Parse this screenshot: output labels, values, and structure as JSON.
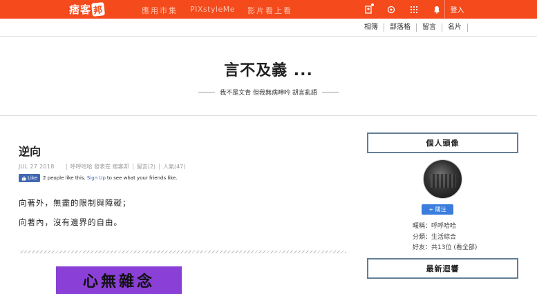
{
  "topbar": {
    "logo_text": "痞客",
    "logo_box": "邦",
    "nav": [
      "應用市集",
      "PIXstyleMe",
      "影片看上看"
    ],
    "icons": [
      "bookmark-icon",
      "search-icon",
      "grid-icon",
      "bell-icon"
    ],
    "login_label": "登入",
    "bg_color": "#f44a1c"
  },
  "subnav": [
    "相簿",
    "部落格",
    "留言",
    "名片"
  ],
  "header": {
    "title": "言不及義 ...",
    "subtitle": "我不是文青 但我無病呻吟 胡言亂語"
  },
  "post": {
    "title": "逆向",
    "date": "JUL 27 2018",
    "author": "呼呼哈哈",
    "posted_in": "發表在",
    "site": "痞客邦",
    "comments": "留言(2)",
    "views": "人氣(47)",
    "fb_like": "Like",
    "fb_count_text": "2 people like this.",
    "fb_signup": "Sign Up",
    "fb_tail": "to see what your friends like.",
    "paragraphs": [
      "向著外，無盡的限制與障礙；",
      "向著內，沒有邊界的自由。"
    ],
    "image_text": "心無雜念"
  },
  "sidebar": {
    "profile_title": "個人頭像",
    "follow_label": "+ 關注",
    "nickname": "暱稱：呼呼哈哈",
    "category": "分類：生活綜合",
    "friends": "好友：共13位 (看全部)",
    "latest_title": "最新迴響"
  }
}
